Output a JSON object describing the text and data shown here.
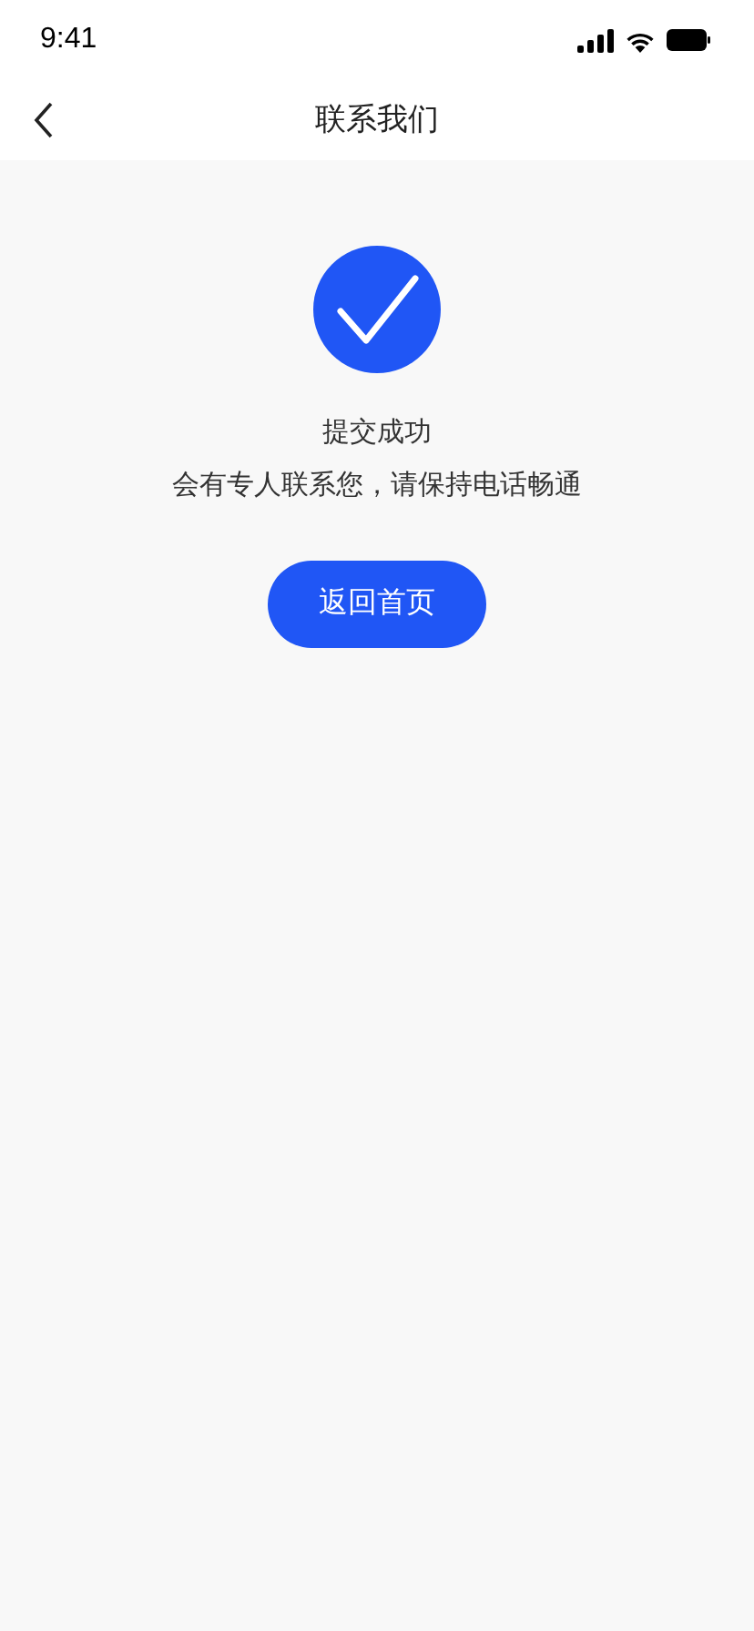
{
  "status_bar": {
    "time": "9:41"
  },
  "nav": {
    "title": "联系我们"
  },
  "result": {
    "title": "提交成功",
    "message": "会有专人联系您，请保持电话畅通"
  },
  "button": {
    "label": "返回首页"
  }
}
